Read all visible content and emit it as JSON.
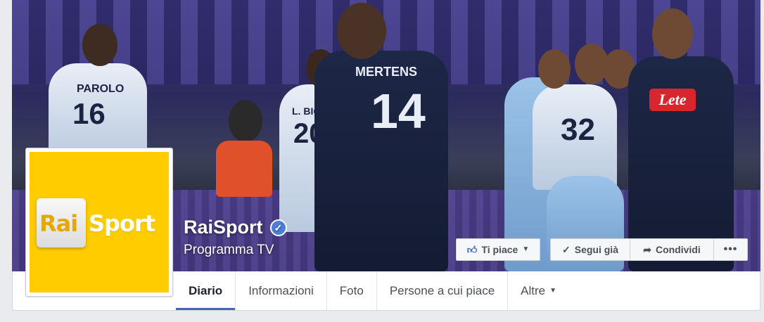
{
  "page": {
    "name": "RaiSport",
    "category": "Programma TV",
    "verified_icon": "check-icon"
  },
  "profile_logo": {
    "word1": "Rai",
    "word2": "Sport",
    "background": "#ffcc00"
  },
  "cover": {
    "jersey_parolo": "PAROLO",
    "jersey_16": "16",
    "jersey_mertens": "MERTENS",
    "jersey_14": "14",
    "jersey_lbig": "L. BIG",
    "jersey_20": "20",
    "jersey_32": "32",
    "sponsor": "Lete"
  },
  "actions": {
    "like_label": "Ti piace",
    "follow_label": "Segui già",
    "share_label": "Condividi",
    "more_label": "•••"
  },
  "tabs": [
    {
      "label": "Diario",
      "active": true
    },
    {
      "label": "Informazioni",
      "active": false
    },
    {
      "label": "Foto",
      "active": false
    },
    {
      "label": "Persone a cui piace",
      "active": false
    },
    {
      "label": "Altre",
      "active": false
    }
  ],
  "colors": {
    "accent": "#4267b2",
    "verified": "#4d7ed8"
  }
}
